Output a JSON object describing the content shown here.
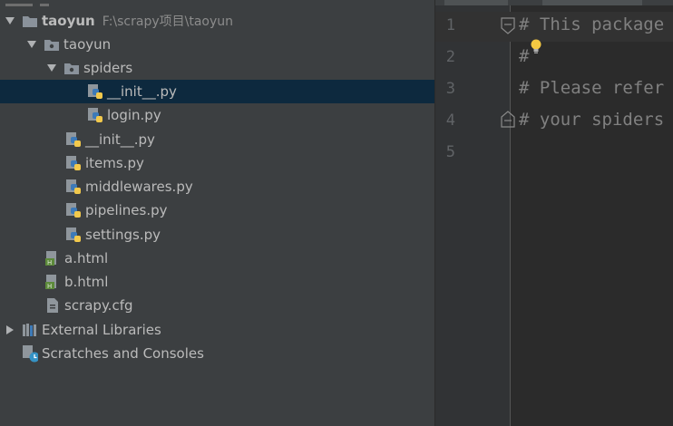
{
  "project_tree": {
    "rows": [
      {
        "label": "taoyun",
        "path": "F:\\scrapy项目\\taoyun",
        "bold": true,
        "icon": "folder-icon",
        "expanded": true
      },
      {
        "label": "taoyun",
        "icon": "package-folder-icon",
        "expanded": true
      },
      {
        "label": "spiders",
        "icon": "package-folder-icon",
        "expanded": true
      },
      {
        "label": "__init__.py",
        "icon": "python-file-icon",
        "selected": true
      },
      {
        "label": "login.py",
        "icon": "python-file-icon"
      },
      {
        "label": "__init__.py",
        "icon": "python-file-icon"
      },
      {
        "label": "items.py",
        "icon": "python-file-icon"
      },
      {
        "label": "middlewares.py",
        "icon": "python-file-icon"
      },
      {
        "label": "pipelines.py",
        "icon": "python-file-icon"
      },
      {
        "label": "settings.py",
        "icon": "python-file-icon"
      },
      {
        "label": "a.html",
        "icon": "html-file-icon"
      },
      {
        "label": "b.html",
        "icon": "html-file-icon"
      },
      {
        "label": "scrapy.cfg",
        "icon": "config-file-icon"
      },
      {
        "label": "External Libraries",
        "icon": "libraries-icon",
        "expanded": false
      },
      {
        "label": "Scratches and Consoles",
        "icon": "scratches-icon"
      }
    ]
  },
  "editor": {
    "line_numbers": [
      "1",
      "2",
      "3",
      "4",
      "5"
    ],
    "code_lines": [
      "# This package",
      "#",
      "# Please refer",
      "# your spiders",
      ""
    ]
  },
  "colors": {
    "panel_bg": "#3c3f41",
    "editor_bg": "#2b2b2b",
    "selection": "#0d293e",
    "text": "#bbbbbb",
    "comment": "#808080"
  }
}
